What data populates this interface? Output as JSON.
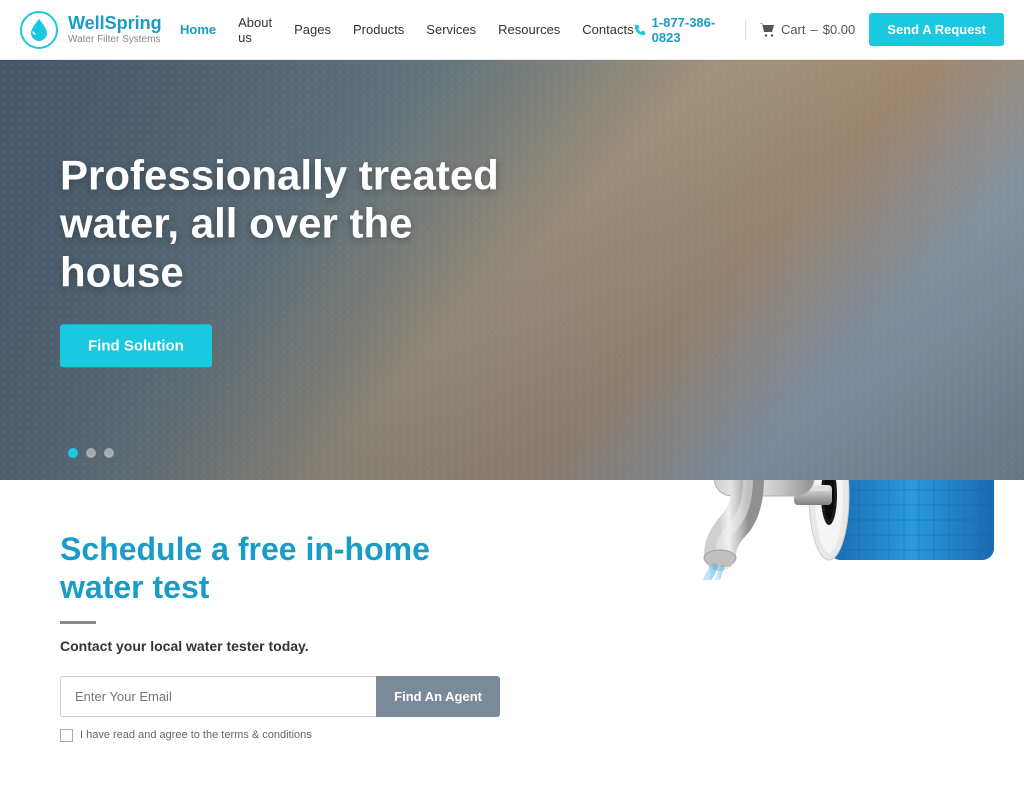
{
  "header": {
    "logo": {
      "brand": "WellSpring",
      "tagline": "Water Filter Systems"
    },
    "nav": [
      {
        "label": "Home",
        "active": true
      },
      {
        "label": "About us",
        "active": false
      },
      {
        "label": "Pages",
        "active": false
      },
      {
        "label": "Products",
        "active": false
      },
      {
        "label": "Services",
        "active": false
      },
      {
        "label": "Resources",
        "active": false
      },
      {
        "label": "Contacts",
        "active": false
      }
    ],
    "phone": "1-877-386-0823",
    "cart_label": "Cart",
    "cart_price": "$0.00",
    "cta_button": "Send A Request"
  },
  "hero": {
    "title": "Professionally treated water, all over the house",
    "cta_button": "Find Solution",
    "dots": [
      {
        "active": true
      },
      {
        "active": false
      },
      {
        "active": false
      }
    ]
  },
  "section2": {
    "title": "Schedule a free in-home water test",
    "subtitle": "Contact your local water tester today.",
    "email_placeholder": "Enter Your Email",
    "find_agent_button": "Find An Agent",
    "terms_text": "I have read and agree to the terms & conditions"
  }
}
